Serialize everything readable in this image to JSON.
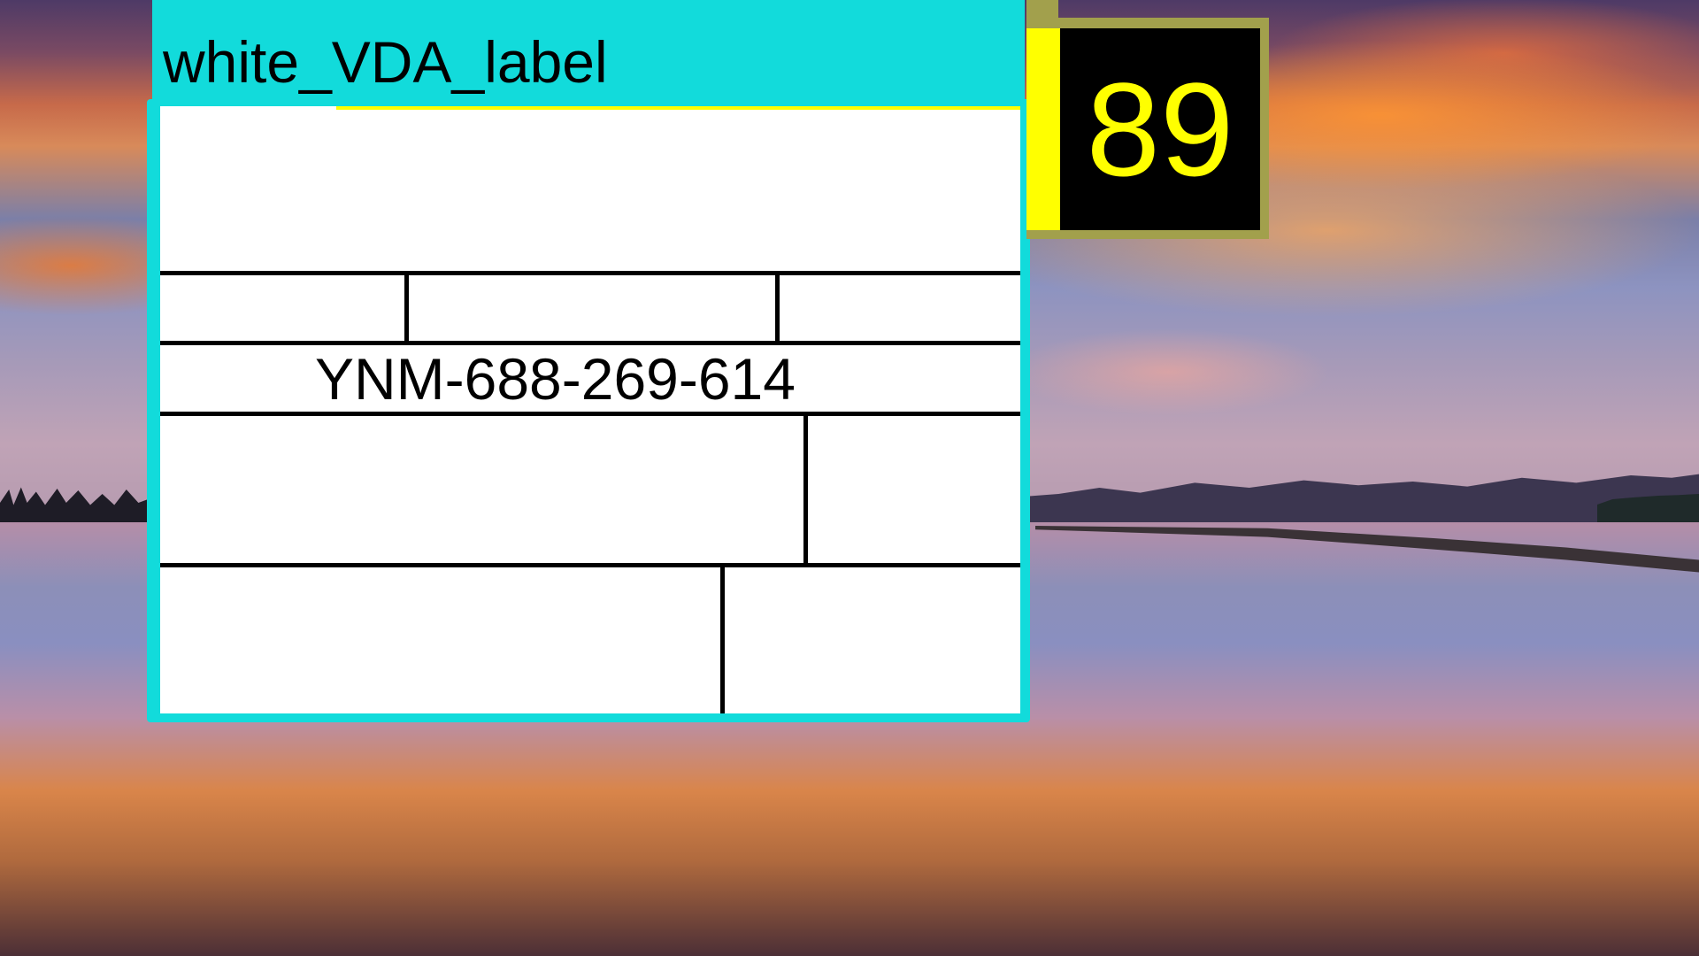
{
  "label_window": {
    "title": "white_VDA_label",
    "accent_color": "#12dbdb",
    "sheet": {
      "background": "#ffffff",
      "serial_number": "YNM-688-269-614"
    }
  },
  "counter": {
    "value": "89",
    "text_color": "#ffff00",
    "background": "#000000",
    "frame_color": "#a2a04c"
  }
}
